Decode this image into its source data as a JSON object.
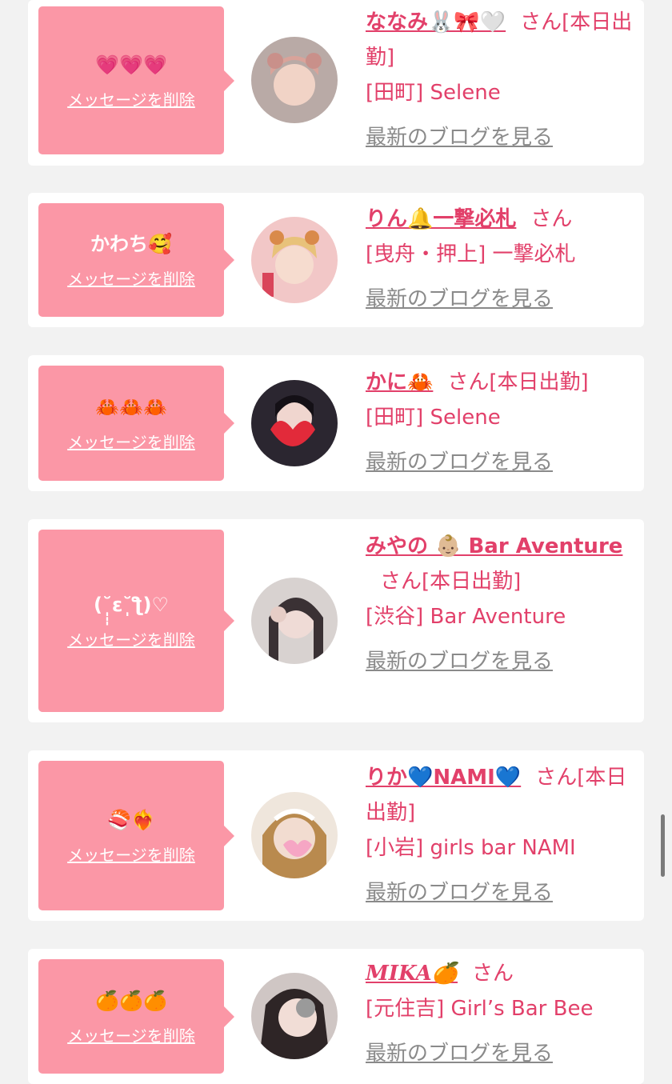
{
  "delete_label": "メッセージを削除",
  "blog_label": "最新のブログを見る",
  "san_label": "さん",
  "cards": [
    {
      "message": "💗💗💗",
      "name": "ななみ🐰🎀🤍",
      "status": "[本日出勤]",
      "shop": "[田町] Selene"
    },
    {
      "message": "かわち🥰",
      "name": "りん🔔一撃必札",
      "status": "",
      "shop": "[曳舟・押上] 一撃必札"
    },
    {
      "message": "🦀🦀🦀",
      "name": "かに🦀",
      "status": "[本日出勤]",
      "shop": "[田町] Selene"
    },
    {
      "message": "(˘̩̩̩ε˘̩ƪ)♡",
      "name": "みやの 👶🏼 Bar Aventure",
      "status": "[本日出勤]",
      "shop": "[渋谷] Bar Aventure"
    },
    {
      "message": "🍣❤️‍🔥",
      "name": "りか💙NAMI💙",
      "status": "[本日出勤]",
      "shop": "[小岩] girls bar NAMI"
    },
    {
      "message": "🍊🍊🍊",
      "name": "MIKA🍊",
      "status": "",
      "shop": "[元住吉] Girl’s Bar Bee"
    }
  ]
}
